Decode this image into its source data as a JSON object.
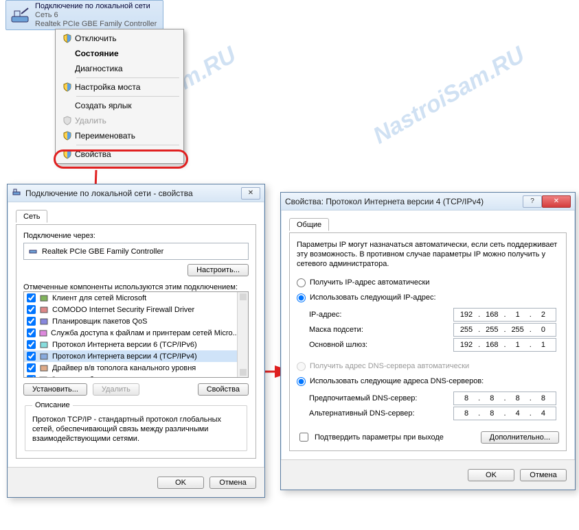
{
  "watermark": "NastroiSam.RU",
  "adapter": {
    "title": "Подключение по локальной сети",
    "line2": "Сеть 6",
    "line3": "Realtek PCIe GBE Family Controller"
  },
  "ctx": {
    "disable": "Отключить",
    "status": "Состояние",
    "diag": "Диагностика",
    "bridge": "Настройка моста",
    "shortcut": "Создать ярлык",
    "delete": "Удалить",
    "rename": "Переименовать",
    "props": "Свойства"
  },
  "propsDlg": {
    "title": "Подключение по локальной сети - свойства",
    "tab": "Сеть",
    "connectVia": "Подключение через:",
    "adapter": "Realtek PCIe GBE Family Controller",
    "configure": "Настроить...",
    "componentsLabel": "Отмеченные компоненты используются этим подключением:",
    "items": [
      "Клиент для сетей Microsoft",
      "COMODO Internet Security Firewall Driver",
      "Планировщик пакетов QoS",
      "Служба доступа к файлам и принтерам сетей Micro...",
      "Протокол Интернета версии 6 (TCP/IPv6)",
      "Протокол Интернета версии 4 (TCP/IPv4)",
      "Драйвер в/в тополога канального уровня",
      "Ответчик обнаружения топологии канального уровня"
    ],
    "install": "Установить...",
    "remove": "Удалить",
    "properties": "Свойства",
    "descTitle": "Описание",
    "descText": "Протокол TCP/IP - стандартный протокол глобальных сетей, обеспечивающий связь между различными взаимодействующими сетями.",
    "ok": "OK",
    "cancel": "Отмена"
  },
  "ipv4Dlg": {
    "title": "Свойства: Протокол Интернета версии 4 (TCP/IPv4)",
    "tab": "Общие",
    "intro": "Параметры IP могут назначаться автоматически, если сеть поддерживает эту возможность. В противном случае параметры IP можно получить у сетевого администратора.",
    "autoIp": "Получить IP-адрес автоматически",
    "manualIp": "Использовать следующий IP-адрес:",
    "ipLabel": "IP-адрес:",
    "maskLabel": "Маска подсети:",
    "gwLabel": "Основной шлюз:",
    "ip": [
      "192",
      "168",
      "1",
      "2"
    ],
    "mask": [
      "255",
      "255",
      "255",
      "0"
    ],
    "gw": [
      "192",
      "168",
      "1",
      "1"
    ],
    "autoDns": "Получить адрес DNS-сервера автоматически",
    "manualDns": "Использовать следующие адреса DNS-серверов:",
    "dns1Label": "Предпочитаемый DNS-сервер:",
    "dns2Label": "Альтернативный DNS-сервер:",
    "dns1": [
      "8",
      "8",
      "8",
      "8"
    ],
    "dns2": [
      "8",
      "8",
      "4",
      "4"
    ],
    "confirmExit": "Подтвердить параметры при выходе",
    "advanced": "Дополнительно...",
    "ok": "OK",
    "cancel": "Отмена"
  }
}
